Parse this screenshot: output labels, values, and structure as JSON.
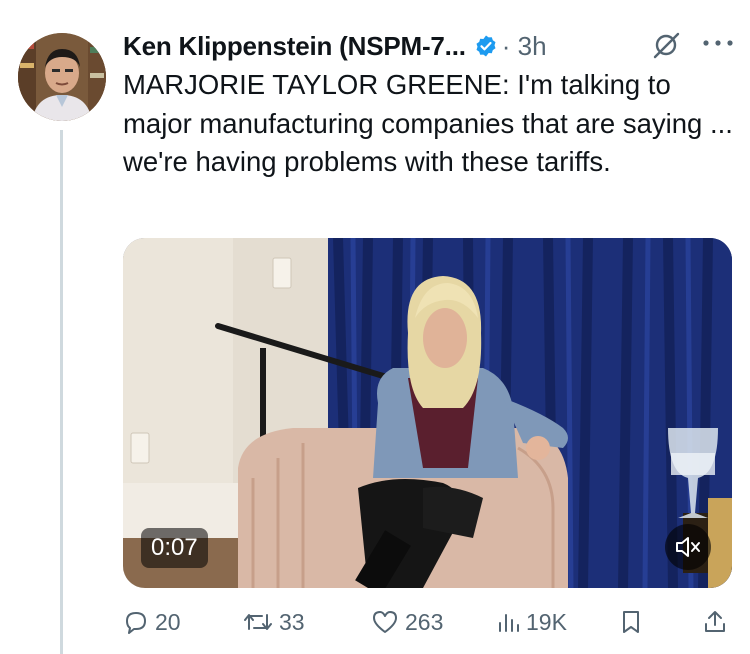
{
  "tweet": {
    "author_name": "Ken Klippenstein (NSPM-7...",
    "separator_time": "· 3h",
    "text": "MARJORIE TAYLOR GREENE: I'm talking to major manufacturing companies that are saying ... we're having problems with these tariffs.",
    "video_duration": "0:07"
  },
  "actions": {
    "replies": "20",
    "reposts": "33",
    "likes": "263",
    "views": "19K"
  },
  "colors": {
    "verified_blue": "#1d9bf0",
    "muted_text": "#536471",
    "thread_line": "#cfd9de"
  },
  "icons": [
    "verified-badge-icon",
    "grok-icon",
    "more-icon",
    "reply-icon",
    "repost-icon",
    "like-icon",
    "views-icon",
    "bookmark-icon",
    "share-icon",
    "mute-icon"
  ]
}
